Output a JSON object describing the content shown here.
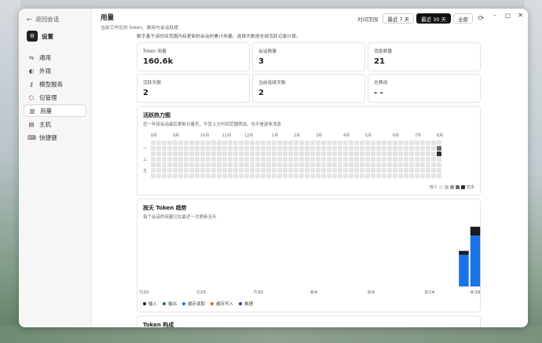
{
  "sidebar": {
    "back_label": "返回会话",
    "settings_label": "设置",
    "items": [
      {
        "label": "通用",
        "icon": "sliders-icon"
      },
      {
        "label": "外观",
        "icon": "palette-icon"
      },
      {
        "label": "模型服务",
        "icon": "key-icon"
      },
      {
        "label": "包管理",
        "icon": "package-icon"
      },
      {
        "label": "用量",
        "icon": "chart-icon"
      },
      {
        "label": "主机",
        "icon": "server-icon"
      },
      {
        "label": "快捷键",
        "icon": "keyboard-icon"
      }
    ],
    "active_index": 4
  },
  "header": {
    "title": "用量",
    "subtitle": "当前工作区的 token、费用与会话跃度",
    "range_label": "时间范围",
    "ranges": [
      "最近 7 天",
      "最近 30 天",
      "全部"
    ],
    "selected_range": 1
  },
  "note": "数字基于该时间范围内有更新的会话的累计用量。选择大数按全部活跃记录计算。",
  "stats": [
    {
      "key": "Token 用量",
      "value": "160.6k"
    },
    {
      "key": "会话数量",
      "value": "3"
    },
    {
      "key": "消息数量",
      "value": "21"
    },
    {
      "key": "活跃天数",
      "value": "2"
    },
    {
      "key": "当前连续天数",
      "value": "2"
    },
    {
      "key": "总费用",
      "value": "- -"
    }
  ],
  "heatmap": {
    "title": "活跃热力图",
    "subtitle": "近一年按会话最后更新日着色，不受上方时间范围筛选，也不是逐条消息",
    "months": [
      "8月",
      "9月",
      "10月",
      "11月",
      "12月",
      "1月",
      "2月",
      "3月",
      "4月",
      "5月",
      "6月",
      "7月",
      "8月"
    ],
    "day_labels": [
      "一",
      "三",
      "五"
    ],
    "legend_less": "较少",
    "legend_more": "较多",
    "colors": [
      "#e4e4e6",
      "#c4c4c8",
      "#9a9aa0",
      "#6a6a70",
      "#2c2c30"
    ],
    "active_days": [
      {
        "week": 52,
        "day": 1,
        "level": 3
      },
      {
        "week": 52,
        "day": 2,
        "level": 4
      }
    ]
  },
  "trend": {
    "title": "按天 Token 趋势",
    "subtitle": "每个会话的用量记在最近一次更新当天",
    "x_ticks": [
      "7/20",
      "7/25",
      "7/30",
      "8/4",
      "8/9",
      "8/14",
      "8/18"
    ],
    "legend": [
      {
        "name": "输入",
        "color": "#1a1a1a"
      },
      {
        "name": "输出",
        "color": "#1f7a3a"
      },
      {
        "name": "缓存读取",
        "color": "#1a73e8"
      },
      {
        "name": "缓存写入",
        "color": "#d9641a"
      },
      {
        "name": "推理",
        "color": "#1a3fa8"
      }
    ]
  },
  "chart_data": {
    "type": "bar",
    "categories": [
      "7/20",
      "7/21",
      "7/22",
      "7/23",
      "7/24",
      "7/25",
      "7/26",
      "7/27",
      "7/28",
      "7/29",
      "7/30",
      "7/31",
      "8/1",
      "8/2",
      "8/3",
      "8/4",
      "8/5",
      "8/6",
      "8/7",
      "8/8",
      "8/9",
      "8/10",
      "8/11",
      "8/12",
      "8/13",
      "8/14",
      "8/15",
      "8/16",
      "8/17",
      "8/18"
    ],
    "series": [
      {
        "name": "输入",
        "values": [
          0,
          0,
          0,
          0,
          0,
          0,
          0,
          0,
          0,
          0,
          0,
          0,
          0,
          0,
          0,
          0,
          0,
          0,
          0,
          0,
          0,
          0,
          0,
          0,
          0,
          0,
          0,
          0,
          6,
          14
        ]
      },
      {
        "name": "输出",
        "values": [
          0,
          0,
          0,
          0,
          0,
          0,
          0,
          0,
          0,
          0,
          0,
          0,
          0,
          0,
          0,
          0,
          0,
          0,
          0,
          0,
          0,
          0,
          0,
          0,
          0,
          0,
          0,
          0,
          0,
          0
        ]
      },
      {
        "name": "缓存读取",
        "values": [
          0,
          0,
          0,
          0,
          0,
          0,
          0,
          0,
          0,
          0,
          0,
          0,
          0,
          0,
          0,
          0,
          0,
          0,
          0,
          0,
          0,
          0,
          0,
          0,
          0,
          0,
          0,
          0,
          50,
          80
        ]
      },
      {
        "name": "缓存写入",
        "values": [
          0,
          0,
          0,
          0,
          0,
          0,
          0,
          0,
          0,
          0,
          0,
          0,
          0,
          0,
          0,
          0,
          0,
          0,
          0,
          0,
          0,
          0,
          0,
          0,
          0,
          0,
          0,
          0,
          0,
          0
        ]
      },
      {
        "name": "推理",
        "values": [
          0,
          0,
          0,
          0,
          0,
          0,
          0,
          0,
          0,
          0,
          0,
          0,
          0,
          0,
          0,
          0,
          0,
          0,
          0,
          0,
          0,
          0,
          0,
          0,
          0,
          0,
          0,
          0,
          0,
          0
        ]
      }
    ]
  },
  "composition": {
    "title": "Token 构成"
  }
}
